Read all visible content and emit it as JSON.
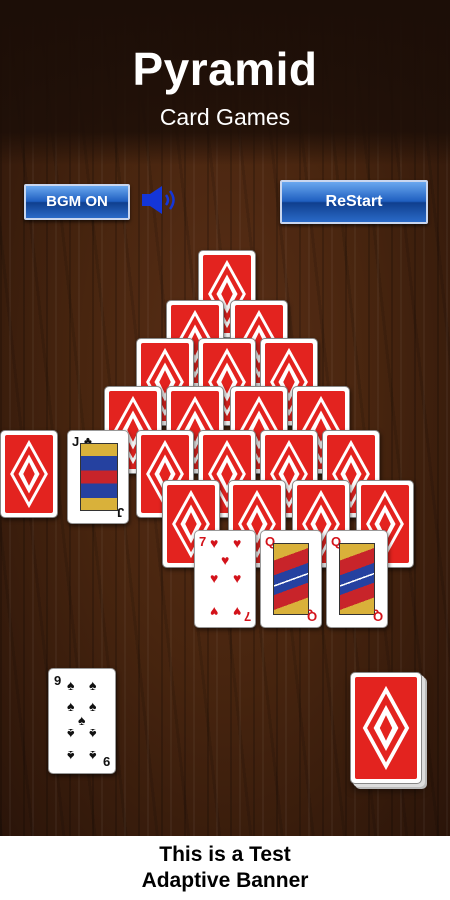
{
  "header": {
    "title": "Pyramid",
    "subtitle": "Card Games"
  },
  "controls": {
    "bgm_label": "BGM ON",
    "restart_label": "ReStart",
    "speaker_icon": "speaker-on-icon"
  },
  "colors": {
    "card_back_red": "#e3231f",
    "button_blue": "#1f5fc0",
    "table_wood": "#48250f"
  },
  "pyramid_rows": [
    1,
    2,
    3,
    4,
    5,
    4
  ],
  "face_up_cards": [
    {
      "id": "jack-clubs",
      "rank": "J",
      "suit": "♣",
      "color": "black"
    },
    {
      "id": "seven-hearts",
      "rank": "7",
      "suit": "♥",
      "color": "red"
    },
    {
      "id": "queen-hearts",
      "rank": "Q",
      "suit": "♥",
      "color": "red"
    },
    {
      "id": "queen-hearts-2",
      "rank": "Q",
      "suit": "♥",
      "color": "red"
    }
  ],
  "waste_card": {
    "rank": "9",
    "suit": "♠",
    "color": "black"
  },
  "banner": {
    "line1": "This is a Test",
    "line2": "Adaptive Banner"
  }
}
